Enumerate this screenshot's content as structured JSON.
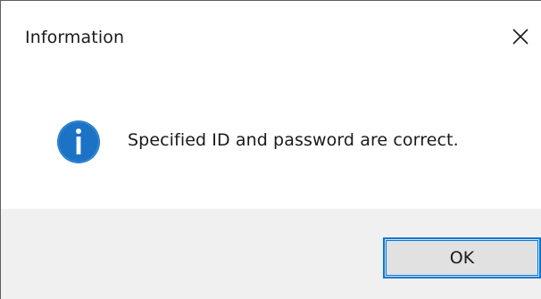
{
  "window": {
    "title": "Information",
    "close_icon": "close-icon"
  },
  "content": {
    "icon": "info-icon",
    "icon_color": "#1c72c4",
    "message": "Specified ID and password are correct."
  },
  "footer": {
    "ok_label": "OK",
    "background": "#f0f0f0",
    "accent": "#0078d7"
  }
}
